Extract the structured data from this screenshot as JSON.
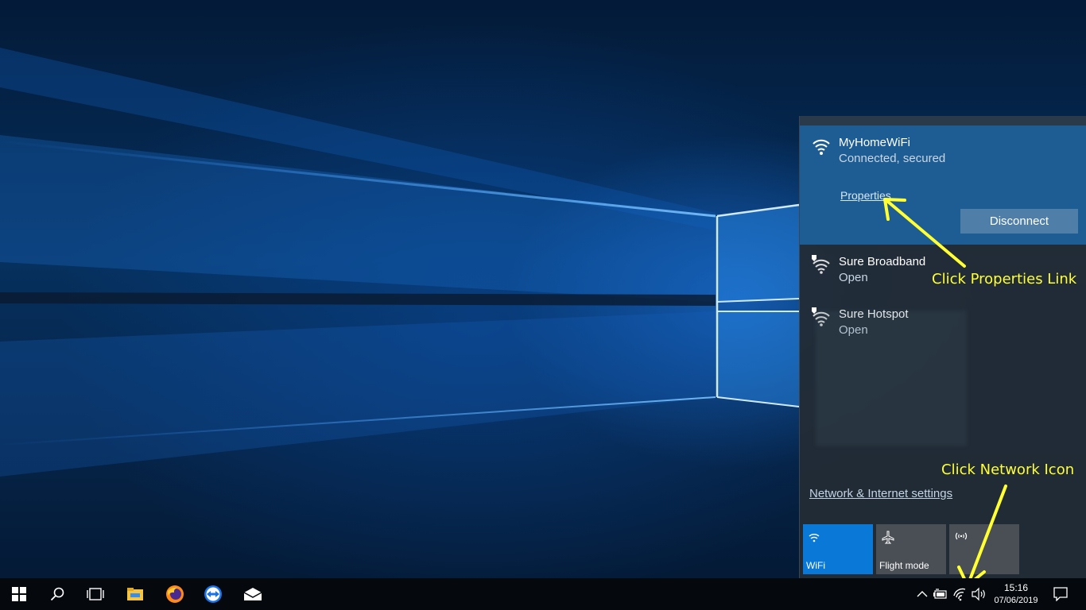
{
  "connected_network": {
    "name": "MyHomeWiFi",
    "status": "Connected, secured",
    "properties_label": "Properties",
    "disconnect_label": "Disconnect"
  },
  "networks": [
    {
      "name": "Sure Broadband",
      "status": "Open"
    },
    {
      "name": "Sure Hotspot",
      "status": "Open"
    }
  ],
  "settings_link": "Network & Internet settings",
  "quick_actions": [
    {
      "label": "WiFi",
      "icon": "wifi-icon",
      "active": true,
      "color": "#0a78d7"
    },
    {
      "label": "Flight mode",
      "icon": "airplane-icon",
      "active": false,
      "color": "#4a4f55"
    },
    {
      "label": "",
      "icon": "mobile-hotspot-icon",
      "active": false,
      "color": "#4a4f55"
    }
  ],
  "annotations": {
    "properties": "Click Properties Link",
    "network_icon": "Click Network Icon",
    "color": "#ffff33"
  },
  "taskbar": {
    "apps": [
      "start-icon",
      "search-icon",
      "task-view-icon",
      "file-explorer-icon",
      "firefox-icon",
      "teamviewer-icon",
      "mail-icon"
    ],
    "tray": [
      "chevron-up-icon",
      "battery-icon",
      "wifi-icon",
      "volume-icon"
    ],
    "time": "15:16",
    "date": "07/06/2019"
  },
  "colors": {
    "accent": "#0a78d7",
    "connected_bg": "#1e5d93",
    "flyout_bg": "#222c36"
  }
}
